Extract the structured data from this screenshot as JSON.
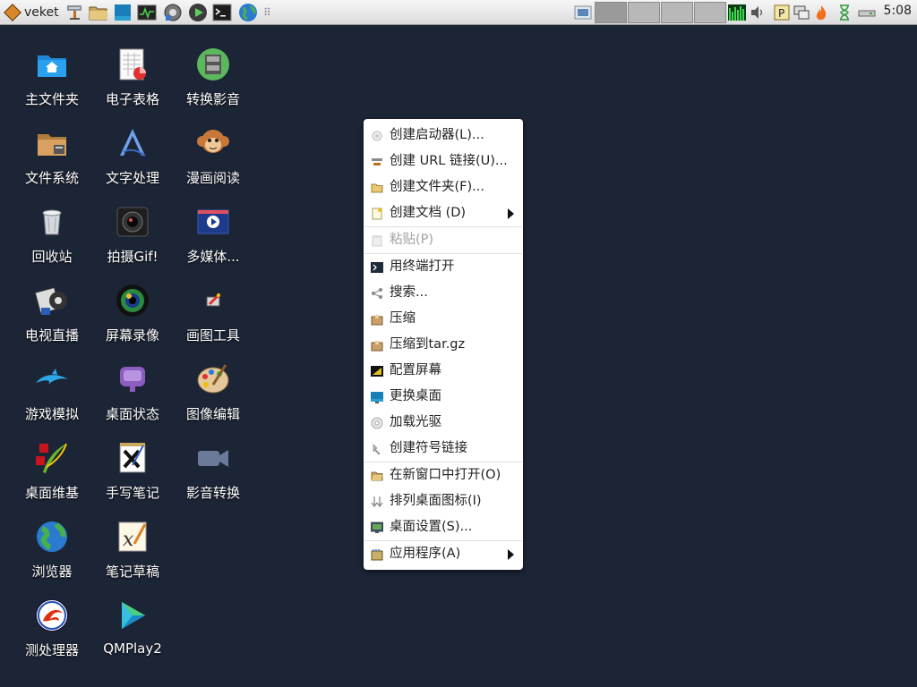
{
  "taskbar": {
    "menu_label": "veket",
    "clock": "5:08",
    "launchers": [
      {
        "name": "network-icon"
      },
      {
        "name": "folder-icon"
      },
      {
        "name": "desktop-icon"
      },
      {
        "name": "system-monitor-icon"
      },
      {
        "name": "media-player-icon"
      },
      {
        "name": "play-icon"
      },
      {
        "name": "terminal-icon"
      },
      {
        "name": "globe-icon"
      }
    ],
    "separator": "⠿"
  },
  "desktop": {
    "icons": [
      {
        "label": "主文件夹"
      },
      {
        "label": "电子表格"
      },
      {
        "label": "转换影音"
      },
      {
        "label": "文件系统"
      },
      {
        "label": "文字处理"
      },
      {
        "label": "漫画阅读"
      },
      {
        "label": "回收站"
      },
      {
        "label": "拍摄Gif!"
      },
      {
        "label": "多媒体..."
      },
      {
        "label": "电视直播"
      },
      {
        "label": "屏幕录像"
      },
      {
        "label": "画图工具"
      },
      {
        "label": "游戏模拟"
      },
      {
        "label": "桌面状态"
      },
      {
        "label": "图像编辑"
      },
      {
        "label": "桌面维基"
      },
      {
        "label": "手写笔记"
      },
      {
        "label": "影音转换"
      },
      {
        "label": "浏览器"
      },
      {
        "label": "笔记草稿"
      },
      {
        "label": "测处理器"
      },
      {
        "label": "QMPlay2"
      }
    ]
  },
  "context_menu": {
    "items": [
      {
        "label": "创建启动器(L)..."
      },
      {
        "label": "创建 URL 链接(U)..."
      },
      {
        "label": "创建文件夹(F)..."
      },
      {
        "label": "创建文档 (D)"
      },
      {
        "label": "粘贴(P)"
      },
      {
        "label": "用终端打开"
      },
      {
        "label": "搜索..."
      },
      {
        "label": "压缩"
      },
      {
        "label": "压缩到tar.gz"
      },
      {
        "label": "配置屏幕"
      },
      {
        "label": "更换桌面"
      },
      {
        "label": "加载光驱"
      },
      {
        "label": "创建符号链接"
      },
      {
        "label": "在新窗口中打开(O)"
      },
      {
        "label": "排列桌面图标(I)"
      },
      {
        "label": "桌面设置(S)..."
      },
      {
        "label": "应用程序(A)"
      }
    ]
  },
  "colors": {
    "desktop_bg": "#1c2536",
    "menu_bg": "#ffffff",
    "disabled_text": "#a0a0a0"
  }
}
